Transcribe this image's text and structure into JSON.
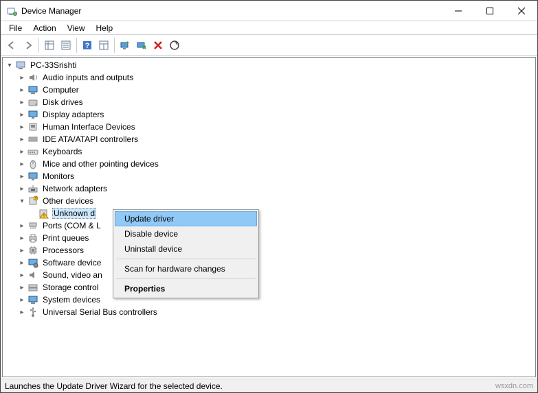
{
  "window": {
    "title": "Device Manager"
  },
  "menu": {
    "file": "File",
    "action": "Action",
    "view": "View",
    "help": "Help"
  },
  "tree": {
    "root": "PC-33Srishti",
    "items": [
      {
        "label": "Audio inputs and outputs"
      },
      {
        "label": "Computer"
      },
      {
        "label": "Disk drives"
      },
      {
        "label": "Display adapters"
      },
      {
        "label": "Human Interface Devices"
      },
      {
        "label": "IDE ATA/ATAPI controllers"
      },
      {
        "label": "Keyboards"
      },
      {
        "label": "Mice and other pointing devices"
      },
      {
        "label": "Monitors"
      },
      {
        "label": "Network adapters"
      },
      {
        "label": "Other devices"
      },
      {
        "label": "Unknown d"
      },
      {
        "label": "Ports (COM & L"
      },
      {
        "label": "Print queues"
      },
      {
        "label": "Processors"
      },
      {
        "label": "Software device"
      },
      {
        "label": "Sound, video an"
      },
      {
        "label": "Storage control"
      },
      {
        "label": "System devices"
      },
      {
        "label": "Universal Serial Bus controllers"
      }
    ]
  },
  "context": {
    "update": "Update driver",
    "disable": "Disable device",
    "uninstall": "Uninstall device",
    "scan": "Scan for hardware changes",
    "properties": "Properties"
  },
  "status": {
    "text": "Launches the Update Driver Wizard for the selected device."
  },
  "watermark": "wsxdn.com"
}
